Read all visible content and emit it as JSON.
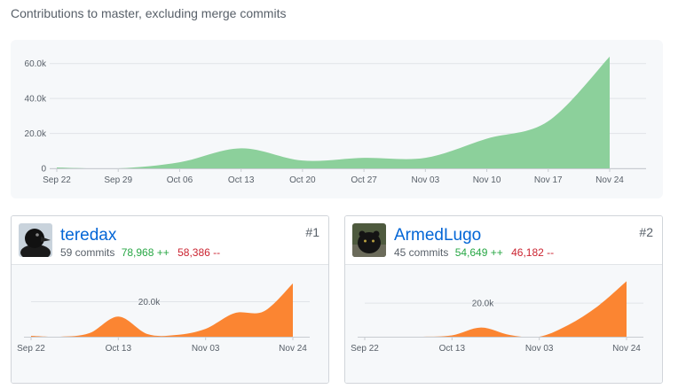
{
  "page": {
    "heading": "Contributions to master, excluding merge commits"
  },
  "colors": {
    "main_area": "#8cd09b",
    "user_area": "#fb8532",
    "additions": "#28a745",
    "deletions": "#cb2431",
    "link": "#0366d6"
  },
  "chart_data": [
    {
      "type": "area",
      "title": "Contributions to master, excluding merge commits",
      "x": [
        "Sep 22",
        "Sep 29",
        "Oct 06",
        "Oct 13",
        "Oct 20",
        "Oct 27",
        "Nov 03",
        "Nov 10",
        "Nov 17",
        "Nov 24"
      ],
      "x_tick_labels": [
        "Sep 22",
        "Sep 29",
        "Oct 06",
        "Oct 13",
        "Oct 20",
        "Oct 27",
        "Nov 03",
        "Nov 10",
        "Nov 17",
        "Nov 24"
      ],
      "values": [
        500,
        0,
        3500,
        11500,
        4500,
        6000,
        6000,
        17000,
        27000,
        64000
      ],
      "y_ticks": [
        0,
        20000,
        40000,
        60000
      ],
      "y_tick_labels": [
        "0",
        "20.0k",
        "40.0k",
        "60.0k"
      ],
      "ylim": [
        0,
        70000
      ],
      "grid": true,
      "color": "#8cd09b"
    },
    {
      "type": "area",
      "x": [
        "Sep 22",
        "Sep 29",
        "Oct 06",
        "Oct 13",
        "Oct 20",
        "Oct 27",
        "Nov 03",
        "Nov 10",
        "Nov 17",
        "Nov 24"
      ],
      "x_tick_labels": [
        "Sep 22",
        "Oct 13",
        "Nov 03",
        "Nov 24"
      ],
      "values": [
        500,
        0,
        2000,
        11500,
        1500,
        1000,
        4500,
        13500,
        14500,
        30500
      ],
      "y_ticks": [
        20000
      ],
      "y_tick_labels": [
        "20.0k"
      ],
      "ylim": [
        0,
        37000
      ],
      "grid": true,
      "color": "#fb8532"
    },
    {
      "type": "area",
      "x": [
        "Sep 22",
        "Sep 29",
        "Oct 06",
        "Oct 13",
        "Oct 20",
        "Oct 27",
        "Nov 03",
        "Nov 10",
        "Nov 17",
        "Nov 24"
      ],
      "x_tick_labels": [
        "Sep 22",
        "Oct 13",
        "Nov 03",
        "Nov 24"
      ],
      "values": [
        0,
        0,
        0,
        800,
        5500,
        1000,
        0,
        7000,
        18000,
        33000
      ],
      "y_ticks": [
        20000
      ],
      "y_tick_labels": [
        "20.0k"
      ],
      "ylim": [
        0,
        38500
      ],
      "grid": true,
      "color": "#fb8532"
    }
  ],
  "contributors": [
    {
      "username": "teredax",
      "commits": "59 commits",
      "additions": "78,968 ++",
      "deletions": "58,386 --",
      "rank": "#1",
      "avatar": "crow-avatar"
    },
    {
      "username": "ArmedLugo",
      "commits": "45 commits",
      "additions": "54,649 ++",
      "deletions": "46,182 --",
      "rank": "#2",
      "avatar": "panther-avatar"
    }
  ]
}
